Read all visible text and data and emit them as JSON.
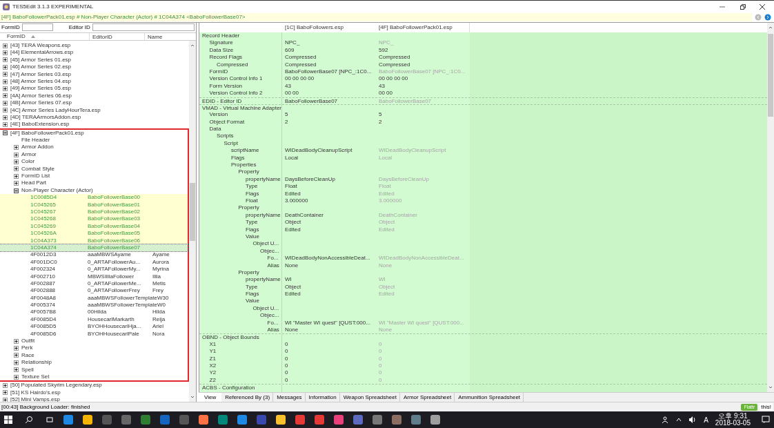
{
  "window": {
    "title": "TES5Edit 3.1.3 EXPERIMENTAL"
  },
  "path_bar": {
    "text": "[4F] BaboFollowerPack01.esp # Non-Player Character (Actor) # 1C04A374 <BaboFollowerBase07>"
  },
  "filters": [
    {
      "label": "FormID"
    },
    {
      "label": "Editor ID"
    }
  ],
  "tree": {
    "columns": [
      "FormID",
      "EditorID",
      "Name"
    ],
    "items": [
      {
        "label": "[43] TERA Weapons.esp",
        "expanded": false
      },
      {
        "label": "[44] ElementalArrows.esp",
        "expanded": false
      },
      {
        "label": "[45] Armor Series 01.esp",
        "expanded": false
      },
      {
        "label": "[46] Armor Series 02.esp",
        "expanded": false
      },
      {
        "label": "[47] Armor Series 03.esp",
        "expanded": false
      },
      {
        "label": "[48] Armor Series 04.esp",
        "expanded": false
      },
      {
        "label": "[49] Armor Series 05.esp",
        "expanded": false
      },
      {
        "label": "[4A] Armor Series 06.esp",
        "expanded": false
      },
      {
        "label": "[4B] Armor Series 07.esp",
        "expanded": false
      },
      {
        "label": "[4C] Armor Series LadyHourTera.esp",
        "expanded": false
      },
      {
        "label": "[4D] TERAArmorsAddon.esp",
        "expanded": false
      },
      {
        "label": "[4E] BaboExtension.esp",
        "expanded": false
      },
      {
        "label": "[4F] BaboFollowerPack01.esp",
        "expanded": true,
        "marked": true,
        "children": [
          {
            "label": "File Header"
          },
          {
            "label": "Armor Addon",
            "expanded": false
          },
          {
            "label": "Armor",
            "expanded": false
          },
          {
            "label": "Color",
            "expanded": false
          },
          {
            "label": "Combat Style",
            "expanded": false
          },
          {
            "label": "FormID List",
            "expanded": false
          },
          {
            "label": "Head Part",
            "expanded": false
          },
          {
            "label": "Non-Player Character (Actor)",
            "expanded": true,
            "children": [
              {
                "form_id": "1C0085D4",
                "editor_id": "BaboFollowerBase00",
                "highlighted": true,
                "selected": false
              },
              {
                "form_id": "1C045265",
                "editor_id": "BaboFollowerBase01",
                "highlighted": true,
                "selected": false
              },
              {
                "form_id": "1C045267",
                "editor_id": "BaboFollowerBase02",
                "highlighted": true,
                "selected": false
              },
              {
                "form_id": "1C045268",
                "editor_id": "BaboFollowerBase03",
                "highlighted": true,
                "selected": false
              },
              {
                "form_id": "1C045269",
                "editor_id": "BaboFollowerBase04",
                "highlighted": true,
                "selected": false
              },
              {
                "form_id": "1C04526A",
                "editor_id": "BaboFollowerBase05",
                "highlighted": true,
                "selected": false
              },
              {
                "form_id": "1C04A373",
                "editor_id": "BaboFollowerBase06",
                "highlighted": true,
                "selected": false
              },
              {
                "form_id": "1C04A374",
                "editor_id": "BaboFollowerBase07",
                "highlighted": true,
                "selected": true
              },
              {
                "form_id": "4F0012D3",
                "editor_id": "aaaMBWSAyame",
                "name": "Ayame",
                "highlighted": false,
                "selected": false
              },
              {
                "form_id": "4F001DC0",
                "editor_id": "0_ARTAFollowerAu...",
                "name": "Aurora",
                "highlighted": false,
                "selected": false
              },
              {
                "form_id": "4F002324",
                "editor_id": "0_ARTAFollowerMy...",
                "name": "Myrina",
                "highlighted": false,
                "selected": false
              },
              {
                "form_id": "4F002710",
                "editor_id": "MBWSIlliaFollower",
                "name": "Illia",
                "highlighted": false,
                "selected": false
              },
              {
                "form_id": "4F002887",
                "editor_id": "0_ARTAFollowerMe...",
                "name": "Metis",
                "highlighted": false,
                "selected": false
              },
              {
                "form_id": "4F002888",
                "editor_id": "0_ARTAFollowerFrey",
                "name": "Frey",
                "highlighted": false,
                "selected": false
              },
              {
                "form_id": "4F0048A8",
                "editor_id": "aaaMBWSFollowerTemplateW30",
                "highlighted": false,
                "selected": false
              },
              {
                "form_id": "4F005374",
                "editor_id": "aaaMBWSFollowerTemplateW0",
                "highlighted": false,
                "selected": false
              },
              {
                "form_id": "4F0057B8",
                "editor_id": "00Hilda",
                "name": "Hilda",
                "highlighted": false,
                "selected": false
              },
              {
                "form_id": "4F0085D4",
                "editor_id": "HousecarlMarkarth",
                "name": "Reija",
                "highlighted": false,
                "selected": false
              },
              {
                "form_id": "4F0085D5",
                "editor_id": "BYOHHousecarlHja...",
                "name": "Ariel",
                "highlighted": false,
                "selected": false
              },
              {
                "form_id": "4F0085D6",
                "editor_id": "BYOHHousecarlPale",
                "name": "Nora",
                "highlighted": false,
                "selected": false
              }
            ]
          },
          {
            "label": "Outfit",
            "expanded": false
          },
          {
            "label": "Perk",
            "expanded": false
          },
          {
            "label": "Race",
            "expanded": false
          },
          {
            "label": "Relationship",
            "expanded": false
          },
          {
            "label": "Spell",
            "expanded": false
          },
          {
            "label": "Texture Set",
            "expanded": false
          }
        ]
      },
      {
        "label": "[50] Populated Skyrim Legendary.esp",
        "expanded": false
      },
      {
        "label": "[51] KS Hairdo's.esp",
        "expanded": false
      },
      {
        "label": "[52] Mini Vamps.esp",
        "expanded": false
      }
    ]
  },
  "record_view": {
    "columns": [
      "[1C] BaboFollowers.esp",
      "[4F] BaboFollowerPack01.esp"
    ],
    "rows": [
      {
        "label": "Record Header",
        "children": [
          {
            "label": "Signature",
            "values": [
              "NPC_",
              "NPC_"
            ],
            "dimmed": true
          },
          {
            "label": "Data Size",
            "values": [
              "609",
              "592"
            ],
            "dimmed": false
          },
          {
            "label": "Record Flags",
            "values": [
              "Compressed",
              "Compressed"
            ],
            "dimmed": false,
            "children": [
              {
                "label": "Compressed",
                "values": [
                  "Compressed",
                  "Compressed"
                ],
                "dimmed": false
              }
            ]
          },
          {
            "label": "FormID",
            "values": [
              "BaboFollowerBase07 [NPC_:1C0...",
              "BaboFollowerBase07 [NPC_:1C0..."
            ],
            "dimmed": true
          },
          {
            "label": "Version Control Info 1",
            "values": [
              "00 00 00 00",
              "00 00 00 00"
            ],
            "dimmed": false
          },
          {
            "label": "Form Version",
            "values": [
              "43",
              "43"
            ],
            "dimmed": false
          },
          {
            "label": "Version Control Info 2",
            "values": [
              "00 00",
              "00 00"
            ],
            "dimmed": false
          }
        ]
      },
      {
        "label": "EDID - Editor ID",
        "values": [
          "BaboFollowerBase07",
          "BaboFollowerBase07"
        ],
        "dimmed": true
      },
      {
        "label": "VMAD - Virtual Machine Adapter",
        "children": [
          {
            "label": "Version",
            "values": [
              "5",
              "5"
            ],
            "dimmed": false
          },
          {
            "label": "Object Format",
            "values": [
              "2",
              "2"
            ],
            "dimmed": false
          },
          {
            "label": "Data",
            "children": [
              {
                "label": "Scripts",
                "children": [
                  {
                    "label": "Script",
                    "children": [
                      {
                        "label": "scriptName",
                        "values": [
                          "WIDeadBodyCleanupScript",
                          "WIDeadBodyCleanupScript"
                        ],
                        "dimmed": true
                      },
                      {
                        "label": "Flags",
                        "values": [
                          "Local",
                          "Local"
                        ],
                        "dimmed": true
                      },
                      {
                        "label": "Properties",
                        "children": [
                          {
                            "label": "Property",
                            "children": [
                              {
                                "label": "propertyName",
                                "values": [
                                  "DaysBeforeCleanUp",
                                  "DaysBeforeCleanUp"
                                ],
                                "dimmed": true
                              },
                              {
                                "label": "Type",
                                "values": [
                                  "Float",
                                  "Float"
                                ],
                                "dimmed": true
                              },
                              {
                                "label": "Flags",
                                "values": [
                                  "Edited",
                                  "Edited"
                                ],
                                "dimmed": true
                              },
                              {
                                "label": "Float",
                                "values": [
                                  "3.000000",
                                  "3.000000"
                                ],
                                "dimmed": true
                              }
                            ]
                          },
                          {
                            "label": "Property",
                            "children": [
                              {
                                "label": "propertyName",
                                "values": [
                                  "DeathContainer",
                                  "DeathContainer"
                                ],
                                "dimmed": true
                              },
                              {
                                "label": "Type",
                                "values": [
                                  "Object",
                                  "Object"
                                ],
                                "dimmed": true
                              },
                              {
                                "label": "Flags",
                                "values": [
                                  "Edited",
                                  "Edited"
                                ],
                                "dimmed": true
                              },
                              {
                                "label": "Value",
                                "children": [
                                  {
                                    "label": "Object U...",
                                    "children": [
                                      {
                                        "label": "Objec...",
                                        "children": [
                                          {
                                            "label": "Fo...",
                                            "values": [
                                              "WIDeadBodyNonAccessibleDeat...",
                                              "WIDeadBodyNonAccessibleDeat..."
                                            ],
                                            "dimmed": true
                                          },
                                          {
                                            "label": "Alias",
                                            "values": [
                                              "None",
                                              "None"
                                            ],
                                            "dimmed": true
                                          }
                                        ]
                                      }
                                    ]
                                  }
                                ]
                              }
                            ]
                          },
                          {
                            "label": "Property",
                            "children": [
                              {
                                "label": "propertyName",
                                "values": [
                                  "WI",
                                  "WI"
                                ],
                                "dimmed": true
                              },
                              {
                                "label": "Type",
                                "values": [
                                  "Object",
                                  "Object"
                                ],
                                "dimmed": true
                              },
                              {
                                "label": "Flags",
                                "values": [
                                  "Edited",
                                  "Edited"
                                ],
                                "dimmed": true
                              },
                              {
                                "label": "Value",
                                "children": [
                                  {
                                    "label": "Object U...",
                                    "children": [
                                      {
                                        "label": "Objec...",
                                        "children": [
                                          {
                                            "label": "Fo...",
                                            "values": [
                                              "WI \"Master WI quest\" [QUST:000...",
                                              "WI \"Master WI quest\" [QUST:000..."
                                            ],
                                            "dimmed": true
                                          },
                                          {
                                            "label": "Alias",
                                            "values": [
                                              "None",
                                              "None"
                                            ],
                                            "dimmed": true
                                          }
                                        ]
                                      }
                                    ]
                                  }
                                ]
                              }
                            ]
                          }
                        ]
                      }
                    ]
                  }
                ]
              }
            ]
          }
        ]
      },
      {
        "label": "OBND - Object Bounds",
        "children": [
          {
            "label": "X1",
            "values": [
              "0",
              "0"
            ],
            "dimmed": true
          },
          {
            "label": "Y1",
            "values": [
              "0",
              "0"
            ],
            "dimmed": true
          },
          {
            "label": "Z1",
            "values": [
              "0",
              "0"
            ],
            "dimmed": true
          },
          {
            "label": "X2",
            "values": [
              "0",
              "0"
            ],
            "dimmed": true
          },
          {
            "label": "Y2",
            "values": [
              "0",
              "0"
            ],
            "dimmed": true
          },
          {
            "label": "Z2",
            "values": [
              "0",
              "0"
            ],
            "dimmed": true
          }
        ]
      },
      {
        "label": "ACBS - Configuration"
      }
    ]
  },
  "tabs": [
    {
      "label": "View",
      "selected": true
    },
    {
      "label": "Referenced By (3)",
      "selected": false
    },
    {
      "label": "Messages",
      "selected": false
    },
    {
      "label": "Information",
      "selected": false
    },
    {
      "label": "Weapon Spreadsheet",
      "selected": false
    },
    {
      "label": "Armor Spreadsheet",
      "selected": false
    },
    {
      "label": "Ammunition Spreadsheet",
      "selected": false
    }
  ],
  "status_bar": {
    "text": "[00:43] Background Loader: finished",
    "flattr_button": "Flattr",
    "flattr_text": "this!"
  },
  "taskbar": {
    "ime": "A",
    "time": "오후 9:31",
    "date": "2018-03-05"
  }
}
